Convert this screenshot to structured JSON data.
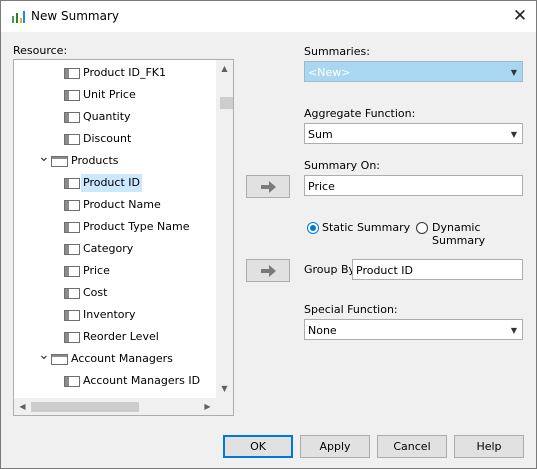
{
  "window": {
    "title": "New Summary"
  },
  "resource": {
    "label": "Resource:",
    "items": [
      {
        "label": "Product ID_FK1",
        "kind": "field"
      },
      {
        "label": "Unit Price",
        "kind": "field"
      },
      {
        "label": "Quantity",
        "kind": "field"
      },
      {
        "label": "Discount",
        "kind": "field"
      },
      {
        "label": "Products",
        "kind": "table",
        "expanded": true
      },
      {
        "label": "Product ID",
        "kind": "field",
        "selected": true
      },
      {
        "label": "Product Name",
        "kind": "field"
      },
      {
        "label": "Product Type Name",
        "kind": "field"
      },
      {
        "label": "Category",
        "kind": "field"
      },
      {
        "label": "Price",
        "kind": "field"
      },
      {
        "label": "Cost",
        "kind": "field"
      },
      {
        "label": "Inventory",
        "kind": "field"
      },
      {
        "label": "Reorder Level",
        "kind": "field"
      },
      {
        "label": "Account Managers",
        "kind": "table",
        "expanded": true
      },
      {
        "label": "Account Managers ID",
        "kind": "field"
      }
    ]
  },
  "summaries": {
    "label": "Summaries:",
    "value": "<New>"
  },
  "aggregate": {
    "label": "Aggregate Function:",
    "value": "Sum"
  },
  "summary_on": {
    "label": "Summary On:",
    "value": "Price"
  },
  "summary_type": {
    "static_label": "Static Summary",
    "dynamic_label": "Dynamic Summary",
    "selected": "static"
  },
  "group_by": {
    "label": "Group By",
    "value": "Product ID"
  },
  "special": {
    "label": "Special Function:",
    "value": "None"
  },
  "buttons": {
    "ok": "OK",
    "apply": "Apply",
    "cancel": "Cancel",
    "help": "Help"
  },
  "colors": {
    "accent": "#0078d7",
    "selection": "#cce8ff",
    "disabled_combo": "#a9d6f0"
  }
}
